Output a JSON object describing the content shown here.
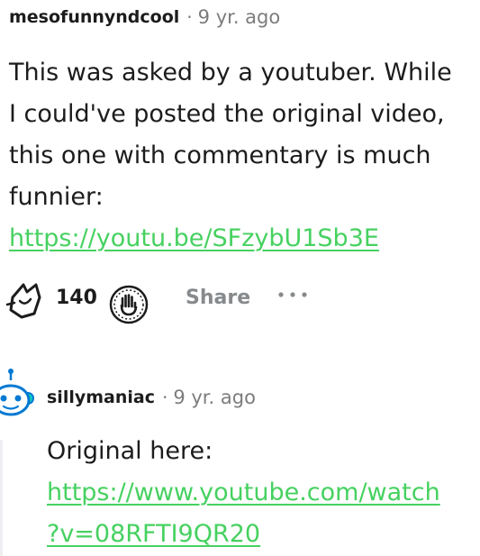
{
  "comment": {
    "username": "mesofunnyndcool",
    "separator": "·",
    "time": "9 yr. ago",
    "body_lines": [
      "This was asked by a youtuber. While",
      "I could've posted the original video,",
      "this one with commentary is much",
      "funnier:"
    ],
    "link": "https://youtu.be/SFzybU1Sb3E"
  },
  "actions": {
    "vote_count": "140",
    "share_label": "Share",
    "upvote_icon": "upvote-icon",
    "award_icon": "award-icon",
    "more_icon": "more-options-icon"
  },
  "reply": {
    "username": "sillymaniac",
    "separator": "·",
    "time": "9 yr. ago",
    "body_text": "Original here:",
    "link_lines": [
      "https://www.youtube.com/watch",
      "?v=08RFTI9QR20"
    ],
    "link_full": "https://www.youtube.com/watch?v=08RFTI9QR20",
    "avatar_icon": "snoo-avatar-icon"
  },
  "colors": {
    "link": "#46d160",
    "meta_gray": "#7c7c7c",
    "action_gray": "#878a8c",
    "avatar_blue": "#0dd3bb"
  }
}
